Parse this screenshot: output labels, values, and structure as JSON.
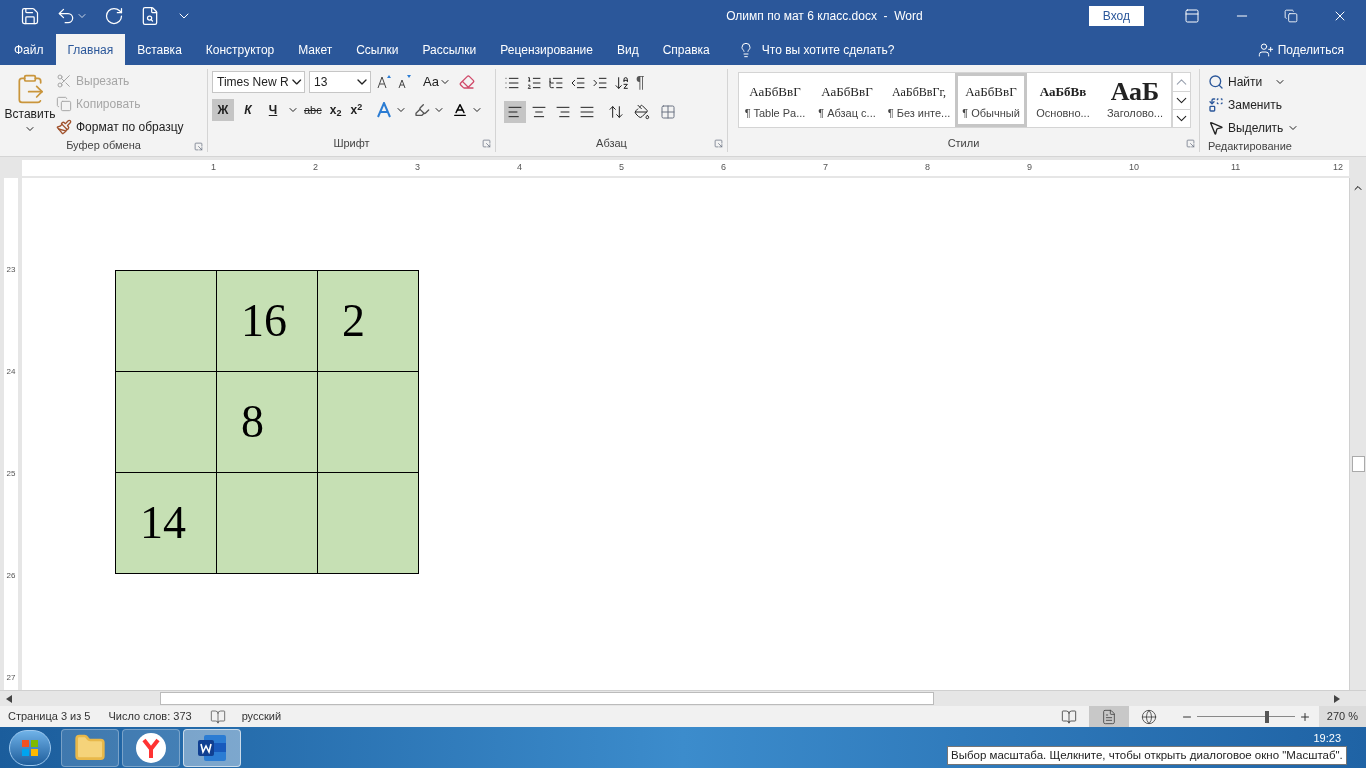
{
  "window": {
    "title": "Олимп по мат 6 класс.docx  -  Word",
    "signin": "Вход"
  },
  "ribbon_tabs": [
    {
      "label": "Файл",
      "selected": false
    },
    {
      "label": "Главная",
      "selected": true
    },
    {
      "label": "Вставка",
      "selected": false
    },
    {
      "label": "Конструктор",
      "selected": false
    },
    {
      "label": "Макет",
      "selected": false
    },
    {
      "label": "Ссылки",
      "selected": false
    },
    {
      "label": "Рассылки",
      "selected": false
    },
    {
      "label": "Рецензирование",
      "selected": false
    },
    {
      "label": "Вид",
      "selected": false
    },
    {
      "label": "Справка",
      "selected": false
    }
  ],
  "tell_me": "Что вы хотите сделать?",
  "share": "Поделиться",
  "clipboard": {
    "paste": "Вставить",
    "cut": {
      "label": "Вырезать",
      "disabled": true
    },
    "copy": {
      "label": "Копировать",
      "disabled": true
    },
    "format_painter": "Формат по образцу",
    "group": "Буфер обмена"
  },
  "font": {
    "name": "Times New R",
    "size": "13",
    "change_case": "Aa",
    "bold": {
      "label": "Ж",
      "selected": true
    },
    "italic": "К",
    "underline": "Ч",
    "strike": "abc",
    "subscript": "x$_{2}$",
    "superscript": "x$^{2}$",
    "group": "Шрифт"
  },
  "paragraph": {
    "align": [
      {
        "kind": "left",
        "selected": true
      },
      {
        "kind": "center",
        "selected": false
      },
      {
        "kind": "right",
        "selected": false
      },
      {
        "kind": "justify",
        "selected": false
      }
    ],
    "pilcrow": "¶",
    "group": "Абзац"
  },
  "styles": {
    "items": [
      {
        "sample": "АаБбВвГ",
        "label": "¶ Table Pa...",
        "kind": "normal",
        "selected": false
      },
      {
        "sample": "АаБбВвГ",
        "label": "¶ Абзац с...",
        "kind": "normal",
        "selected": false
      },
      {
        "sample": "АаБбВвГг,",
        "label": "¶ Без инте...",
        "kind": "small",
        "selected": false
      },
      {
        "sample": "АаБбВвГ",
        "label": "¶ Обычный",
        "kind": "normal",
        "selected": true
      },
      {
        "sample": "АаБбВв",
        "label": "Основно...",
        "kind": "bold",
        "selected": false
      },
      {
        "sample": "АаБ",
        "label": "Заголово...",
        "kind": "heading",
        "selected": false
      }
    ],
    "group": "Стили"
  },
  "editing": {
    "find": "Найти",
    "replace": "Заменить",
    "select": "Выделить",
    "group": "Редактирование"
  },
  "ruler": {
    "horizontal": [
      "1",
      "2",
      "3",
      "4",
      "5",
      "6",
      "7",
      "8",
      "9",
      "10",
      "11",
      "12"
    ],
    "vertical": [
      "23",
      "24",
      "25",
      "26",
      "27"
    ]
  },
  "table": {
    "rows": [
      [
        "",
        "16",
        "2"
      ],
      [
        "",
        "8",
        ""
      ],
      [
        "14",
        "",
        ""
      ]
    ]
  },
  "status_bar": {
    "page": "Страница 3 из 5",
    "words": "Число слов: 373",
    "language": "русский",
    "views": [
      {
        "kind": "read",
        "selected": false
      },
      {
        "kind": "print",
        "selected": true
      },
      {
        "kind": "web",
        "selected": false
      }
    ],
    "zoom": {
      "level": 0.72,
      "reading": "270 %"
    }
  },
  "taskbar": {
    "apps": [
      {
        "kind": "explorer",
        "selected": false
      },
      {
        "kind": "browser",
        "selected": false
      },
      {
        "kind": "word",
        "selected": true
      }
    ],
    "clock": "19:23"
  },
  "tooltip": "Выбор масштаба. Щелкните, чтобы открыть диалоговое окно \"Масштаб\"."
}
